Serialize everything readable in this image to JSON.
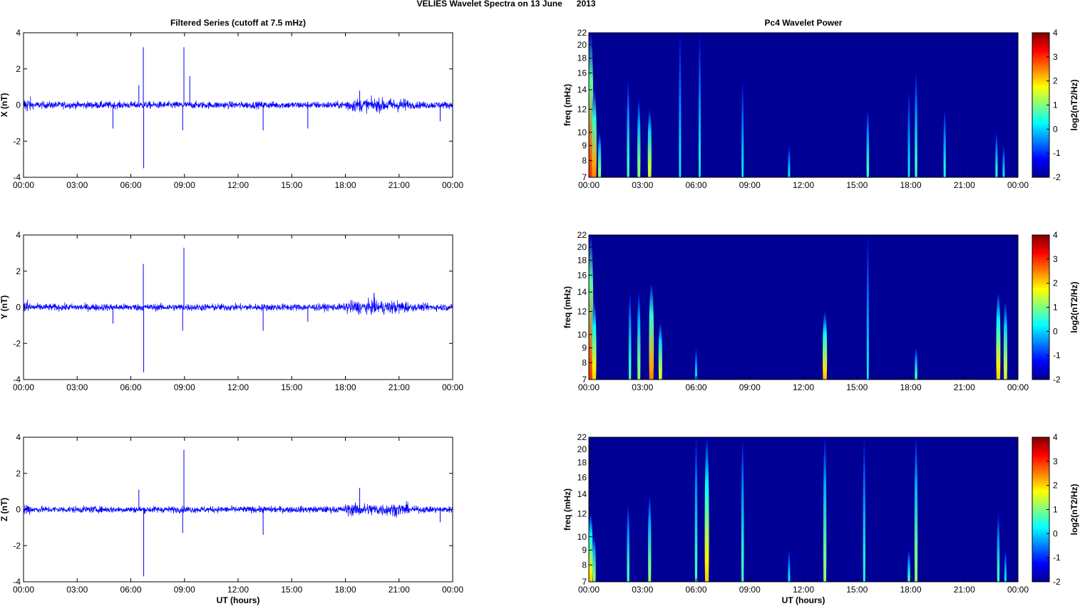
{
  "title": "VELIES Wavelet Spectra on 13 June      2013",
  "chart_data": {
    "type": "line+heatmap",
    "left_title": "Filtered Series (cutoff at 7.5 mHz)",
    "right_title": "Pc4 Wavelet Power",
    "xlabel": "UT (hours)",
    "x_ticks": [
      "00:00",
      "03:00",
      "06:00",
      "09:00",
      "12:00",
      "15:00",
      "18:00",
      "21:00",
      "00:00"
    ],
    "xlim": [
      0,
      24
    ],
    "series_ylim": [
      -4,
      4
    ],
    "series_yticks": [
      "-4",
      "-2",
      "0",
      "2",
      "4"
    ],
    "freq_label": "freq (mHz)",
    "freq_ylim": [
      7,
      22
    ],
    "freq_ticks": [
      "7",
      "8",
      "9",
      "10",
      "12",
      "14",
      "16",
      "18",
      "20",
      "22"
    ],
    "colorbar_label": "log2(nT2/Hz)",
    "colorbar_range": [
      -2,
      4
    ],
    "colorbar_ticks": [
      "-2",
      "-1",
      "0",
      "1",
      "2",
      "3",
      "4"
    ],
    "line_color": "#0000ff",
    "panels": [
      {
        "component": "X",
        "ylabel": "X (nT)",
        "noise": 0.14,
        "spikes": [
          [
            5.0,
            -1.3
          ],
          [
            6.45,
            1.1
          ],
          [
            6.7,
            3.2
          ],
          [
            6.72,
            -3.5
          ],
          [
            8.9,
            -1.4
          ],
          [
            8.97,
            3.2
          ],
          [
            9.3,
            1.6
          ],
          [
            13.4,
            -1.4
          ],
          [
            15.9,
            -1.3
          ],
          [
            18.8,
            0.8
          ],
          [
            23.3,
            -0.9
          ]
        ],
        "events": [
          [
            0.1,
            7,
            22,
            3.6
          ],
          [
            0.3,
            7,
            14,
            3.0
          ],
          [
            0.6,
            7,
            10,
            1.5
          ],
          [
            2.2,
            7,
            15,
            1.0
          ],
          [
            2.8,
            7,
            13,
            1.5
          ],
          [
            3.4,
            7,
            12,
            2.0
          ],
          [
            5.1,
            7,
            22,
            0.5
          ],
          [
            6.2,
            7,
            22,
            0.6
          ],
          [
            8.6,
            7,
            15,
            0.5
          ],
          [
            11.2,
            7,
            9,
            0.5
          ],
          [
            15.6,
            7,
            12,
            1.0
          ],
          [
            17.9,
            7,
            14,
            0.5
          ],
          [
            18.3,
            7,
            16,
            1.0
          ],
          [
            19.9,
            7,
            12,
            0.8
          ],
          [
            22.8,
            7,
            10,
            0.8
          ],
          [
            23.2,
            7,
            9,
            0.5
          ]
        ]
      },
      {
        "component": "Y",
        "ylabel": "Y (nT)",
        "noise": 0.14,
        "spikes": [
          [
            5.0,
            -0.9
          ],
          [
            6.7,
            2.4
          ],
          [
            6.72,
            -3.6
          ],
          [
            8.9,
            -1.3
          ],
          [
            8.97,
            3.3
          ],
          [
            13.4,
            -1.3
          ],
          [
            15.9,
            -0.8
          ],
          [
            19.6,
            0.8
          ]
        ],
        "events": [
          [
            0.1,
            7,
            22,
            3.6
          ],
          [
            0.3,
            7,
            13,
            2.5
          ],
          [
            2.3,
            7,
            14,
            1.0
          ],
          [
            2.8,
            7,
            14,
            1.5
          ],
          [
            3.5,
            7,
            15,
            3.0
          ],
          [
            4.0,
            7,
            11,
            2.0
          ],
          [
            6.0,
            7,
            9,
            0.5
          ],
          [
            13.2,
            7,
            12,
            2.6
          ],
          [
            15.6,
            7,
            22,
            0.5
          ],
          [
            18.3,
            7,
            9,
            1.0
          ],
          [
            22.9,
            7,
            14,
            2.5
          ],
          [
            23.3,
            7,
            13,
            2.0
          ]
        ]
      },
      {
        "component": "Z",
        "ylabel": "Z (nT)",
        "noise": 0.13,
        "spikes": [
          [
            6.45,
            1.1
          ],
          [
            6.72,
            -3.7
          ],
          [
            8.9,
            -1.3
          ],
          [
            8.97,
            3.3
          ],
          [
            13.4,
            -1.4
          ],
          [
            18.8,
            1.2
          ],
          [
            23.3,
            -0.7
          ]
        ],
        "events": [
          [
            0.1,
            7,
            12,
            2.5
          ],
          [
            0.3,
            7,
            10,
            1.5
          ],
          [
            2.2,
            7,
            13,
            1.0
          ],
          [
            3.4,
            7,
            14,
            1.5
          ],
          [
            6.0,
            7,
            22,
            1.0
          ],
          [
            6.6,
            7,
            22,
            2.5
          ],
          [
            8.6,
            7,
            22,
            1.0
          ],
          [
            11.2,
            7,
            9,
            0.5
          ],
          [
            13.2,
            7,
            22,
            1.5
          ],
          [
            15.4,
            7,
            22,
            0.8
          ],
          [
            17.9,
            7,
            9,
            1.0
          ],
          [
            18.3,
            7,
            22,
            1.5
          ],
          [
            22.9,
            7,
            12,
            1.0
          ],
          [
            23.3,
            7,
            9,
            0.5
          ]
        ]
      }
    ]
  }
}
